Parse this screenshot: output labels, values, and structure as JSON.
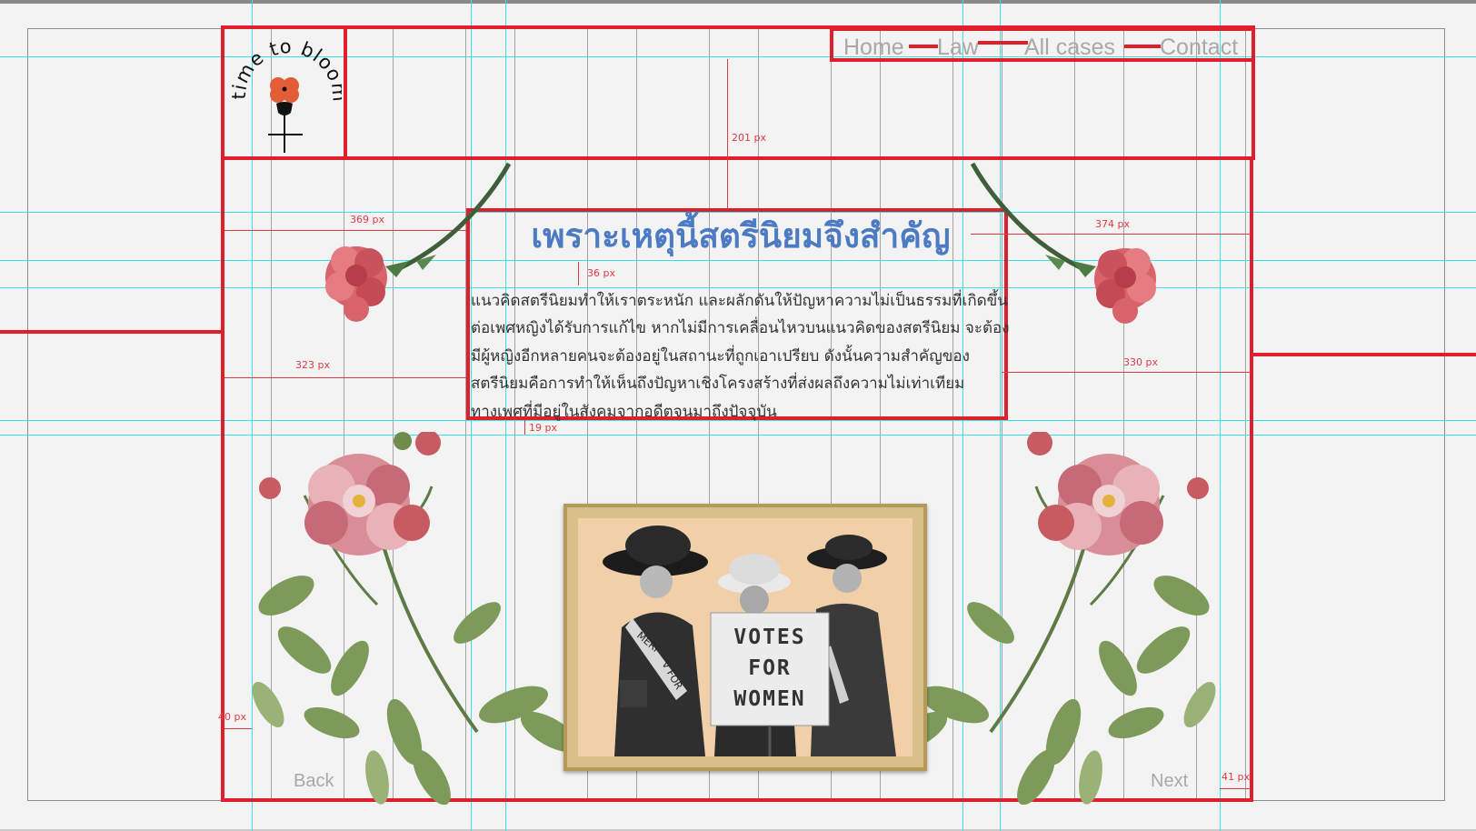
{
  "logo": {
    "text": "time to bloom",
    "letters": [
      "t",
      "i",
      "m",
      "e",
      "t",
      "o",
      "b",
      "l",
      "o",
      "o",
      "m"
    ],
    "flower_color": "#e35d36"
  },
  "nav": {
    "items": [
      "Home",
      "Law",
      "All cases",
      "Contact"
    ]
  },
  "main": {
    "heading": "เพราะเหตุนี้สตรีนิยมจึงสำคัญ",
    "paragraph_lines": [
      "แนวคิดสตรีนิยมทำให้เราตระหนัก และผลักดันให้ปัญหาความไม่เป็นธรรมที่เกิดขึ้น",
      "ต่อเพศหญิงได้รับการแก้ไข หากไม่มีการเคลื่อนไหวบนแนวคิดของสตรีนิยม จะต้อง",
      "มีผู้หญิงอีกหลายคนจะต้องอยู่ในสถานะที่ถูกเอาเปรียบ ดังนั้นความสำคัญของ",
      "สตรีนิยมคือการทำให้เห็นถึงปัญหาเชิงโครงสร้างที่ส่งผลถึงความไม่เท่าเทียม",
      "ทางเพศที่มีอยู่ในสังคมจากอดีตจนมาถึงปัจจุบัน"
    ]
  },
  "photo": {
    "sign_lines": [
      "VOTES",
      "FOR",
      "WOMEN"
    ],
    "sash_left": "MERI",
    "sash_left_2": "V FOR"
  },
  "footer": {
    "back_label": "Back",
    "next_label": "Next"
  },
  "measurements": {
    "top_gap": "201 px",
    "left_heading_gap": "369 px",
    "right_heading_gap": "374 px",
    "heading_para_gap": "36 px",
    "left_para_gap": "323 px",
    "right_para_gap": "330 px",
    "para_bottom_gap": "19 px",
    "left_margin": "40 px",
    "right_margin": "41 px"
  },
  "colors": {
    "accent_red": "#e01f2d",
    "heading_blue": "#4c7bc4",
    "guide_cyan": "#34e6ea",
    "nav_gray": "#a8a8a8"
  }
}
